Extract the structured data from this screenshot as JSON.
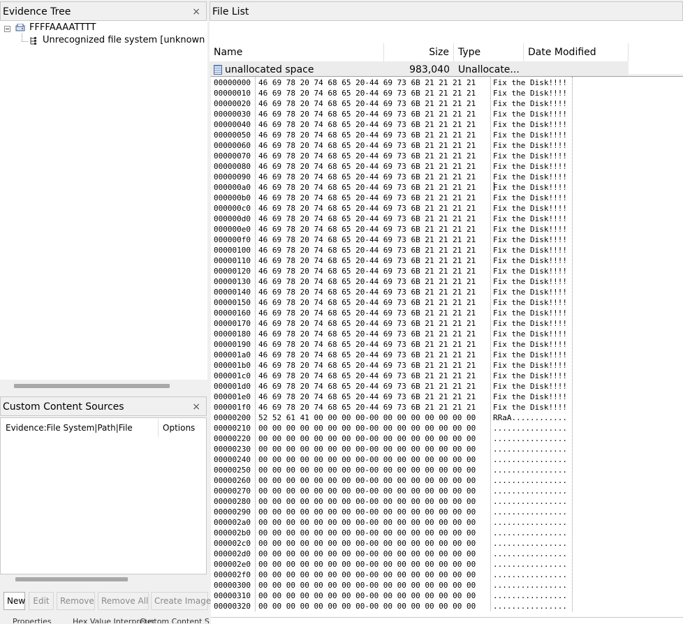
{
  "evidence_tree": {
    "title": "Evidence Tree",
    "close_glyph": "×",
    "root_label": "FFFFAAAATTTT",
    "child_label": "Unrecognized file system [unknown"
  },
  "custom_content": {
    "title": "Custom Content Sources",
    "close_glyph": "×",
    "col_path": "Evidence:File System|Path|File",
    "col_options": "Options",
    "buttons": {
      "new": "New",
      "edit": "Edit",
      "remove": "Remove",
      "remove_all": "Remove All",
      "create_image": "Create Image"
    }
  },
  "bottom_tabs": [
    "Properties",
    "Hex Value Interpreter",
    "Custom Content Sources"
  ],
  "file_list": {
    "title": "File List",
    "columns": {
      "name": "Name",
      "size": "Size",
      "type": "Type",
      "date": "Date Modified"
    },
    "rows": [
      {
        "name": "unallocated space",
        "size": "983,040",
        "type": "Unallocate...",
        "date": ""
      }
    ]
  },
  "hex": {
    "fix_bytes": "46 69 78 20 74 68 65 20-44 69 73 6B 21 21 21 21",
    "fix_ascii": "Fix the Disk!!!!",
    "zero_bytes": "00 00 00 00 00 00 00 00-00 00 00 00 00 00 00 00",
    "zero_ascii": "................",
    "rraa_bytes": "52 52 61 41 00 00 00 00-00 00 00 00 00 00 00 00",
    "rraa_ascii": "RRaA............",
    "offsets": [
      "00000000",
      "00000010",
      "00000020",
      "00000030",
      "00000040",
      "00000050",
      "00000060",
      "00000070",
      "00000080",
      "00000090",
      "000000a0",
      "000000b0",
      "000000c0",
      "000000d0",
      "000000e0",
      "000000f0",
      "00000100",
      "00000110",
      "00000120",
      "00000130",
      "00000140",
      "00000150",
      "00000160",
      "00000170",
      "00000180",
      "00000190",
      "000001a0",
      "000001b0",
      "000001c0",
      "000001d0",
      "000001e0",
      "000001f0",
      "00000200",
      "00000210",
      "00000220",
      "00000230",
      "00000240",
      "00000250",
      "00000260",
      "00000270",
      "00000280",
      "00000290",
      "000002a0",
      "000002b0",
      "000002c0",
      "000002d0",
      "000002e0",
      "000002f0",
      "00000300",
      "00000310",
      "00000320"
    ]
  }
}
